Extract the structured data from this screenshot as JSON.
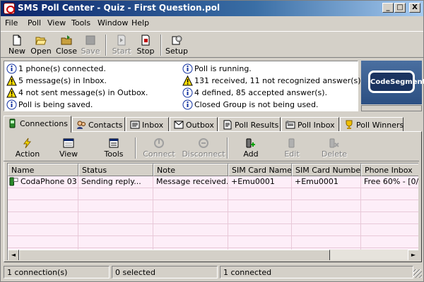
{
  "window": {
    "title": "SMS Poll Center - Quiz - First Question.pol"
  },
  "window_buttons": {
    "min": "_",
    "max": "□",
    "close": "X"
  },
  "menu": [
    "File",
    "Poll",
    "View",
    "Tools",
    "Window",
    "Help"
  ],
  "toolbar": {
    "new": "New",
    "open": "Open",
    "close": "Close",
    "save": "Save",
    "start": "Start",
    "stop": "Stop",
    "setup": "Setup"
  },
  "status_left": [
    {
      "icon": "info-icon",
      "text": "1 phone(s) connected."
    },
    {
      "icon": "warning-icon",
      "text": "5 message(s) in Inbox."
    },
    {
      "icon": "warning-icon",
      "text": "4 not sent message(s) in Outbox."
    },
    {
      "icon": "info-icon",
      "text": "Poll is being saved."
    }
  ],
  "status_right": [
    {
      "icon": "info-icon",
      "text": "Poll is running."
    },
    {
      "icon": "warning-icon",
      "text": "131 received, 11 not recognized answer(s)."
    },
    {
      "icon": "info-icon",
      "text": "4 defined, 85 accepted answer(s)."
    },
    {
      "icon": "info-icon",
      "text": "Closed Group is not being used."
    }
  ],
  "logo": {
    "text": "CodeSegment"
  },
  "tabs": [
    "Connections",
    "Contacts",
    "Inbox",
    "Outbox",
    "Poll Results",
    "Poll Inbox",
    "Poll Winners"
  ],
  "active_tab": "Connections",
  "connections_toolbar": {
    "action": "Action",
    "view": "View",
    "tools": "Tools",
    "connect": "Connect",
    "disconnect": "Disconnect",
    "add": "Add",
    "edit": "Edit",
    "delete": "Delete"
  },
  "grid": {
    "columns": [
      "Name",
      "Status",
      "Note",
      "SIM Card Name",
      "SIM Card Number",
      "Phone Inbox"
    ],
    "rows": [
      [
        "CodaPhone 031",
        "Sending reply...",
        "Message received.",
        "+Emu0001",
        "+Emu0001",
        "Free 60% - [0/..."
      ]
    ],
    "scroll_left": "◄",
    "scroll_right": "►"
  },
  "statusbar": [
    "1 connection(s)",
    "0 selected",
    "1 connected"
  ],
  "colors": {
    "title_start": "#0a246a",
    "title_end": "#a6caf0",
    "grid_row": "#fdeef8"
  }
}
